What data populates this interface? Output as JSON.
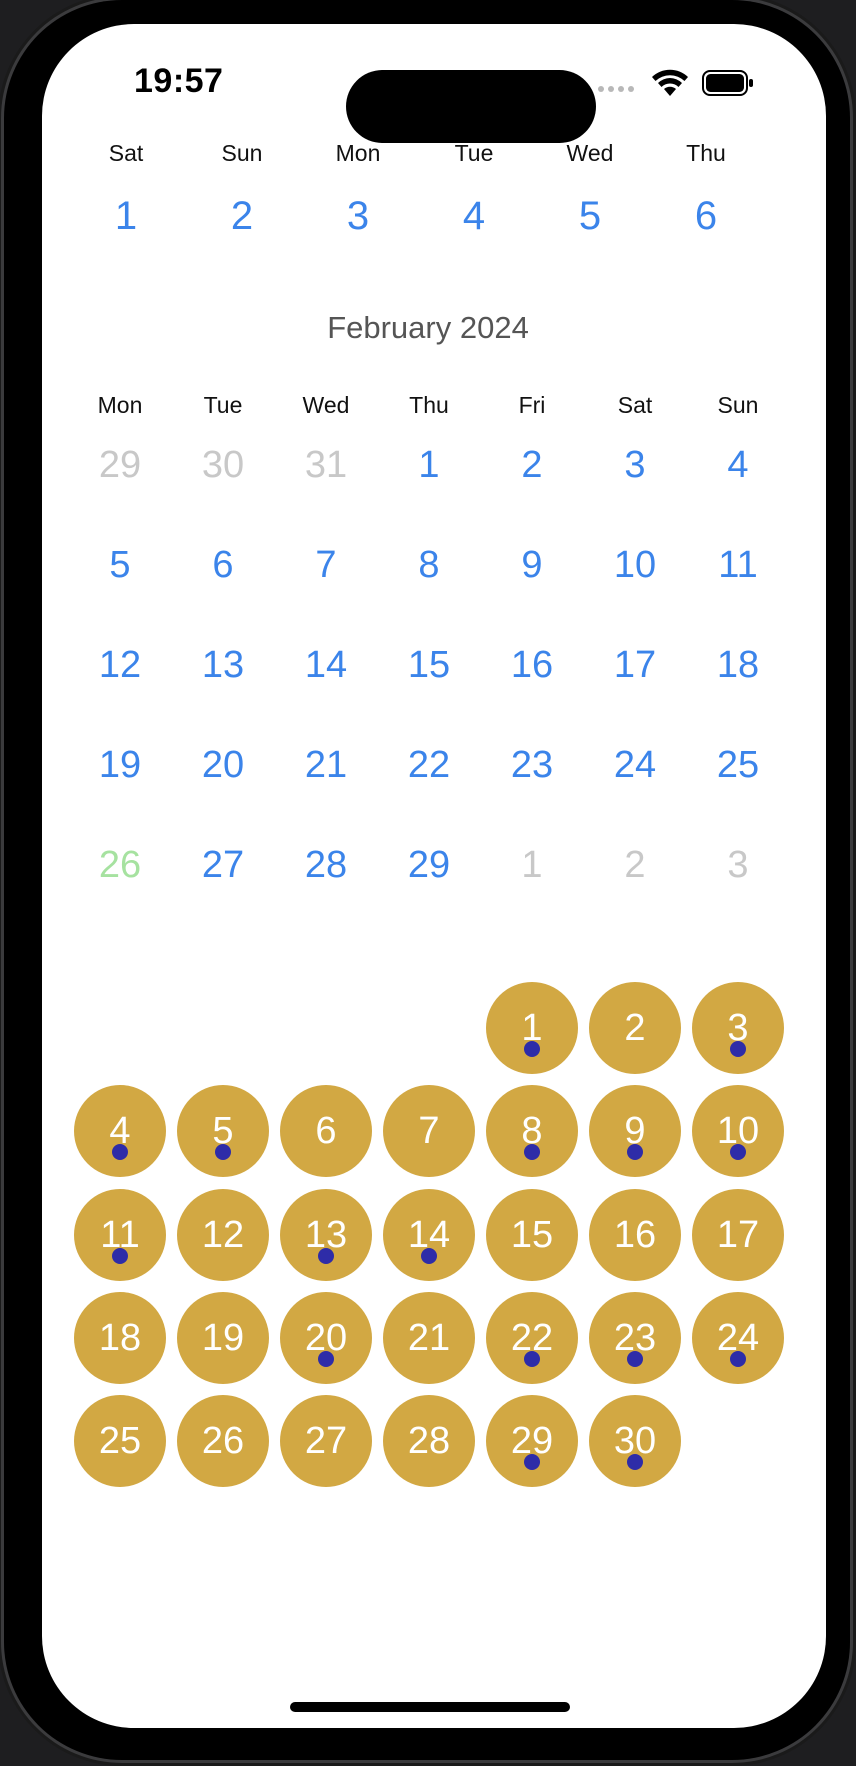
{
  "status_bar": {
    "time": "19:57"
  },
  "week_strip": {
    "days": [
      {
        "label": "Sat",
        "num": "1"
      },
      {
        "label": "Sun",
        "num": "2"
      },
      {
        "label": "Mon",
        "num": "3"
      },
      {
        "label": "Tue",
        "num": "4"
      },
      {
        "label": "Wed",
        "num": "5"
      },
      {
        "label": "Thu",
        "num": "6"
      }
    ]
  },
  "month_calendar": {
    "title": "February 2024",
    "weekday_labels": [
      "Mon",
      "Tue",
      "Wed",
      "Thu",
      "Fri",
      "Sat",
      "Sun"
    ],
    "weeks": [
      [
        {
          "d": "29",
          "s": "out"
        },
        {
          "d": "30",
          "s": "out"
        },
        {
          "d": "31",
          "s": "out"
        },
        {
          "d": "1",
          "s": "in"
        },
        {
          "d": "2",
          "s": "in"
        },
        {
          "d": "3",
          "s": "in"
        },
        {
          "d": "4",
          "s": "in"
        }
      ],
      [
        {
          "d": "5",
          "s": "in"
        },
        {
          "d": "6",
          "s": "in"
        },
        {
          "d": "7",
          "s": "in"
        },
        {
          "d": "8",
          "s": "in"
        },
        {
          "d": "9",
          "s": "in"
        },
        {
          "d": "10",
          "s": "in"
        },
        {
          "d": "11",
          "s": "in"
        }
      ],
      [
        {
          "d": "12",
          "s": "in"
        },
        {
          "d": "13",
          "s": "in"
        },
        {
          "d": "14",
          "s": "in"
        },
        {
          "d": "15",
          "s": "in"
        },
        {
          "d": "16",
          "s": "in"
        },
        {
          "d": "17",
          "s": "in"
        },
        {
          "d": "18",
          "s": "in"
        }
      ],
      [
        {
          "d": "19",
          "s": "in"
        },
        {
          "d": "20",
          "s": "in"
        },
        {
          "d": "21",
          "s": "in"
        },
        {
          "d": "22",
          "s": "in"
        },
        {
          "d": "23",
          "s": "in"
        },
        {
          "d": "24",
          "s": "in"
        },
        {
          "d": "25",
          "s": "in"
        }
      ],
      [
        {
          "d": "26",
          "s": "today"
        },
        {
          "d": "27",
          "s": "in"
        },
        {
          "d": "28",
          "s": "in"
        },
        {
          "d": "29",
          "s": "in"
        },
        {
          "d": "1",
          "s": "out"
        },
        {
          "d": "2",
          "s": "out"
        },
        {
          "d": "3",
          "s": "out"
        }
      ]
    ]
  },
  "event_calendar": {
    "weeks": [
      [
        null,
        null,
        null,
        null,
        {
          "d": "1",
          "dot": true
        },
        {
          "d": "2",
          "dot": false
        },
        {
          "d": "3",
          "dot": true
        }
      ],
      [
        {
          "d": "4",
          "dot": true
        },
        {
          "d": "5",
          "dot": true
        },
        {
          "d": "6",
          "dot": false
        },
        {
          "d": "7",
          "dot": false
        },
        {
          "d": "8",
          "dot": true
        },
        {
          "d": "9",
          "dot": true
        },
        {
          "d": "10",
          "dot": true
        }
      ],
      [
        {
          "d": "11",
          "dot": true
        },
        {
          "d": "12",
          "dot": false
        },
        {
          "d": "13",
          "dot": true
        },
        {
          "d": "14",
          "dot": true
        },
        {
          "d": "15",
          "dot": false
        },
        {
          "d": "16",
          "dot": false
        },
        {
          "d": "17",
          "dot": false
        }
      ],
      [
        {
          "d": "18",
          "dot": false
        },
        {
          "d": "19",
          "dot": false
        },
        {
          "d": "20",
          "dot": true
        },
        {
          "d": "21",
          "dot": false
        },
        {
          "d": "22",
          "dot": true
        },
        {
          "d": "23",
          "dot": true
        },
        {
          "d": "24",
          "dot": true
        }
      ],
      [
        {
          "d": "25",
          "dot": false
        },
        {
          "d": "26",
          "dot": false
        },
        {
          "d": "27",
          "dot": false
        },
        {
          "d": "28",
          "dot": false
        },
        {
          "d": "29",
          "dot": true
        },
        {
          "d": "30",
          "dot": true
        },
        null
      ]
    ]
  },
  "colors": {
    "day_in_month": "#3b84ea",
    "day_out_month": "#c8c8c8",
    "today": "#a6e2a0",
    "event_circle": "#d2a843",
    "event_dot": "#2e2ca8"
  }
}
